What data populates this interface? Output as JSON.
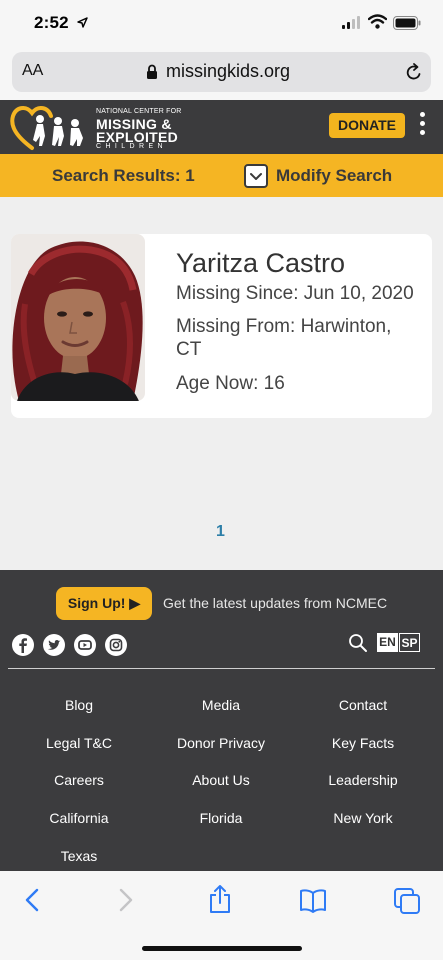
{
  "status": {
    "time": "2:52"
  },
  "browser": {
    "aa_label": "AA",
    "url": "missingkids.org"
  },
  "header": {
    "logo_small": "NATIONAL CENTER FOR",
    "logo_line1": "MISSING &",
    "logo_line2": "EXPLOITED",
    "logo_line3": "CHILDREN",
    "donate_label": "DONATE",
    "brand_color": "#f5b523",
    "header_color": "#3b3b3d"
  },
  "search": {
    "results_label": "Search Results: 1",
    "modify_label": "Modify Search",
    "modify_icon": "chevron-down-icon"
  },
  "result": {
    "name": "Yaritza Castro",
    "missing_since": "Missing Since: Jun 10, 2020",
    "missing_from_line1": "Missing From: Harwinton,",
    "missing_from_line2": "CT",
    "age_now": "Age Now: 16"
  },
  "pagination": {
    "current": "1"
  },
  "footer": {
    "signup_label": "Sign Up! ▶",
    "updates_text": "Get the latest updates from NCMEC",
    "social_icons": [
      "facebook-icon",
      "twitter-icon",
      "youtube-icon",
      "instagram-icon"
    ],
    "lang_en": "EN",
    "lang_sp": "SP",
    "links": [
      "Blog",
      "Media",
      "Contact",
      "Legal T&C",
      "Donor Privacy",
      "Key Facts",
      "Careers",
      "About Us",
      "Leadership",
      "California",
      "Florida",
      "New York",
      "Texas"
    ]
  },
  "toolbar": {
    "icons": [
      "back-icon",
      "forward-icon",
      "share-icon",
      "bookmarks-icon",
      "tabs-icon"
    ]
  }
}
